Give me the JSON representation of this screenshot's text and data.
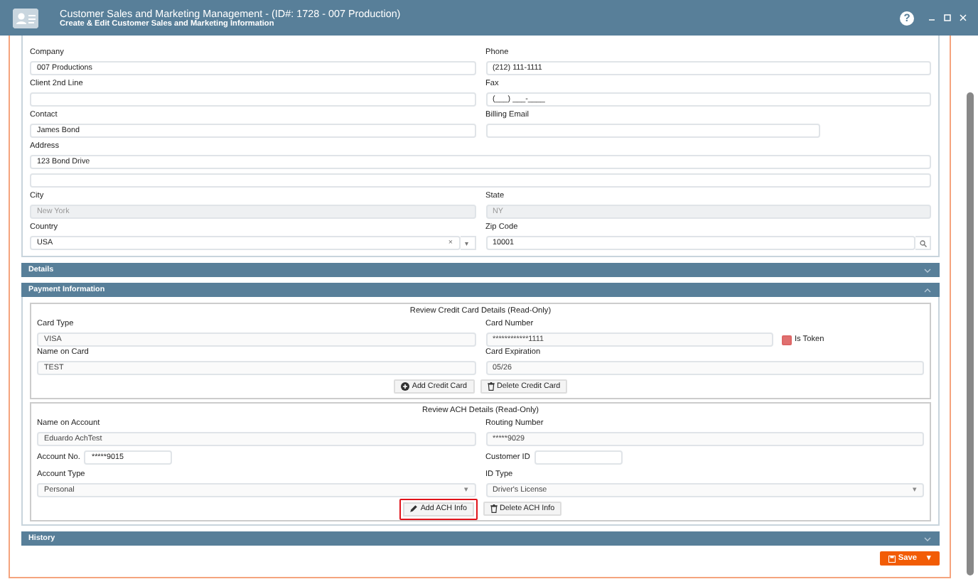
{
  "window": {
    "title": "Customer Sales and Marketing Management - (ID#: 1728 - 007 Production)",
    "subtitle": "Create & Edit Customer Sales and Marketing Information",
    "help": "?"
  },
  "customer": {
    "rows": [
      [
        {
          "label": "Company",
          "value": "007 Productions",
          "kind": "text",
          "disabled": false
        },
        {
          "label": "Phone",
          "value": "(212) 111-1111",
          "kind": "text",
          "disabled": false
        }
      ],
      [
        {
          "label": "Client 2nd Line",
          "kind": "text",
          "disabled": false
        },
        {
          "label": "Fax",
          "value": "(___) ___-____",
          "kind": "text",
          "disabled": false
        }
      ],
      [
        {
          "label": "Contact",
          "value": "James Bond",
          "kind": "text",
          "disabled": false
        },
        {
          "label": "Billing Email",
          "kind": "short",
          "disabled": false
        }
      ],
      [
        {
          "label": "Address",
          "value": "123 Bond Drive",
          "kind": "address",
          "disabled": false
        }
      ],
      [
        {
          "label": "City",
          "value": "New York",
          "kind": "text",
          "disabled": true
        },
        {
          "label": "State",
          "value": "NY",
          "kind": "text",
          "disabled": true
        }
      ],
      [
        {
          "label": "Country",
          "value": "USA",
          "kind": "combo",
          "clear": "×",
          "caret": "▾",
          "disabled": false
        },
        {
          "label": "Zip Code",
          "value": "10001",
          "kind": "search",
          "disabled": false
        }
      ]
    ]
  },
  "sections": [
    {
      "title": "Details",
      "expanded": false
    },
    {
      "title": "Payment Information",
      "expanded": true,
      "panels": [
        {
          "title": "Review Credit Card Details (Read-Only)",
          "rows": [
            [
              {
                "label": "Card Type",
                "value": "VISA",
                "kind": "readonly"
              },
              {
                "label": "Card Number",
                "value": "************1111",
                "kind": "token",
                "token": {
                  "label": "Is Token",
                  "checked": true
                }
              }
            ],
            [
              {
                "label": "Name on Card",
                "value": "TEST",
                "kind": "readonly"
              },
              {
                "label": "Card Expiration",
                "value": "05/26",
                "kind": "readonly"
              }
            ]
          ],
          "buttons": [
            {
              "label": "Add Credit Card",
              "kind": "add",
              "highlighted": false
            },
            {
              "label": "Delete Credit Card",
              "kind": "delete",
              "highlighted": false
            }
          ]
        },
        {
          "title": "Review ACH Details (Read-Only)",
          "rows": [
            [
              {
                "label": "Name on Account",
                "value": "Eduardo AchTest",
                "kind": "readonly"
              },
              {
                "label": "Routing Number",
                "value": "*****9029",
                "kind": "readonly"
              }
            ],
            [
              {
                "label": "Account No.",
                "value": "*****9015",
                "kind": "inline"
              },
              {
                "label": "Customer ID",
                "kind": "inline"
              }
            ],
            [
              {
                "label": "Account Type",
                "value": "Personal",
                "kind": "select",
                "caret": "▾"
              },
              {
                "label": "ID Type",
                "value": "Driver's License",
                "kind": "select",
                "caret": "▾"
              }
            ]
          ],
          "buttons": [
            {
              "label": "Add ACH Info",
              "kind": "edit",
              "highlighted": true
            },
            {
              "label": "Delete ACH Info",
              "kind": "delete",
              "highlighted": false
            }
          ]
        }
      ]
    },
    {
      "title": "History",
      "expanded": false
    }
  ],
  "save": {
    "label": "Save",
    "caret": "▾"
  }
}
